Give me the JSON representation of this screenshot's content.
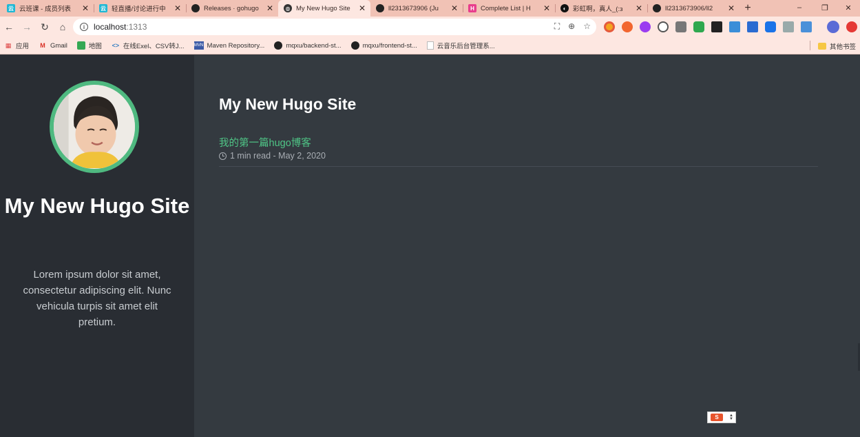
{
  "browser": {
    "tabs": [
      {
        "title": "云班课 - 成员列表",
        "color": "#1fb7d4",
        "active": false
      },
      {
        "title": "轻直播/讨论进行中",
        "color": "#1fb7d4",
        "active": false
      },
      {
        "title": "Releases · gohugo",
        "color": "#222222",
        "active": false
      },
      {
        "title": "My New Hugo Site",
        "color": "#333333",
        "active": true
      },
      {
        "title": "ll2313673906 (Ju",
        "color": "#222222",
        "active": false
      },
      {
        "title": "Complete List | H",
        "color": "#e83e8c",
        "active": false
      },
      {
        "title": "彩虹啊，真人_(:з",
        "color": "#111111",
        "active": false
      },
      {
        "title": "ll2313673906/ll2",
        "color": "#222222",
        "active": false
      }
    ],
    "new_tab_label": "+",
    "window_controls": {
      "minimize": "–",
      "restore": "❐",
      "close": "✕"
    },
    "url": {
      "host": "localhost",
      "port": ":1313"
    },
    "bookmarks": [
      {
        "label": "应用",
        "icon": "apps-grid-icon"
      },
      {
        "label": "Gmail",
        "icon": "gmail-icon"
      },
      {
        "label": "地图",
        "icon": "maps-icon"
      },
      {
        "label": "在线Exel、CSV转J...",
        "icon": "code-icon"
      },
      {
        "label": "Maven Repository...",
        "icon": "mvn-icon"
      },
      {
        "label": "mqxu/backend-st...",
        "icon": "github-icon"
      },
      {
        "label": "mqxu/frontend-st...",
        "icon": "github-icon"
      },
      {
        "label": "云音乐后台管理系...",
        "icon": "page-icon"
      }
    ],
    "other_bookmarks": "其他书签"
  },
  "sidebar": {
    "title": "My New Hugo Site",
    "description": "Lorem ipsum dolor sit amet, consectetur adipiscing elit. Nunc vehicula turpis sit amet elit pretium."
  },
  "main": {
    "title": "My New Hugo Site",
    "posts": [
      {
        "title": "我的第一篇hugo博客",
        "meta": "1 min read - May 2, 2020"
      }
    ]
  },
  "colors": {
    "accent": "#4fc586",
    "sidebar_bg": "#292d33",
    "main_bg": "#343a40",
    "tabbar_bg": "#f1c2b5"
  }
}
